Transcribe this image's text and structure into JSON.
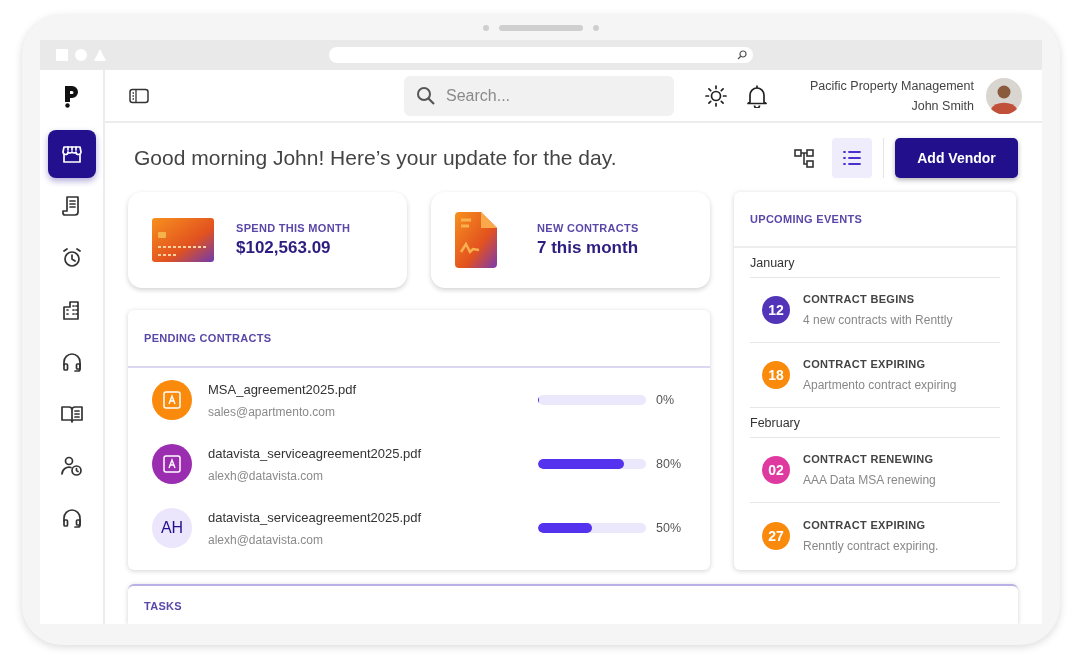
{
  "sidebar": {
    "items": [
      {
        "kind": "store",
        "selected": true
      },
      {
        "kind": "receipt",
        "selected": false
      },
      {
        "kind": "alarm",
        "selected": false
      },
      {
        "kind": "buildings",
        "selected": false
      },
      {
        "kind": "headset",
        "selected": false
      },
      {
        "kind": "book",
        "selected": false
      },
      {
        "kind": "user-clock",
        "selected": false
      },
      {
        "kind": "headset",
        "selected": false
      }
    ]
  },
  "header": {
    "search": {
      "placeholder": "Search..."
    },
    "company": "Pacific Property Management",
    "user": "John Smith"
  },
  "greeting": "Good morning John! Here’s your update for the day.",
  "view_toggle": [
    {
      "kind": "diagram",
      "selected": false
    },
    {
      "kind": "list",
      "selected": true
    }
  ],
  "add_button": "Add Vendor",
  "stats": [
    {
      "kind": "card",
      "label": "SPEND THIS MONTH",
      "value": "$102,563.09"
    },
    {
      "kind": "document",
      "label": "NEW CONTRACTS",
      "value": "7 this month"
    }
  ],
  "pending_contracts": {
    "title": "PENDING CONTRACTS",
    "rows": [
      {
        "kind": "logo",
        "color": "#f98a0c",
        "file": "MSA_agreement2025.pdf",
        "email": "sales@apartmento.com",
        "level": 0,
        "reading": "0%"
      },
      {
        "kind": "logo",
        "color": "#9b2db0",
        "file": "datavista_serviceagreement2025.pdf",
        "email": "alexh@datavista.com",
        "level": 0.8,
        "reading": "80%"
      },
      {
        "kind": "initials",
        "initials": "AH",
        "file": "datavista_serviceagreement2025.pdf",
        "email": "alexh@datavista.com",
        "level": 0.5,
        "reading": "50%"
      }
    ]
  },
  "upcoming_events": {
    "title": "UPCOMING EVENTS",
    "months": [
      {
        "name": "January",
        "events": [
          {
            "day": "12",
            "color": "#5234b8",
            "title": "CONTRACT BEGINS",
            "detail": "4 new contracts with Renttly"
          },
          {
            "day": "18",
            "color": "#f98a0c",
            "title": "CONTRACT EXPIRING",
            "detail": "Apartmento contract expiring"
          }
        ]
      },
      {
        "name": "February",
        "events": [
          {
            "day": "02",
            "color": "#de3aa0",
            "title": "CONTRACT RENEWING",
            "detail": "AAA Data MSA renewing"
          },
          {
            "day": "27",
            "color": "#f98a0c",
            "title": "CONTRACT EXPIRING",
            "detail": "Renntly contract expiring."
          }
        ]
      }
    ]
  },
  "tasks": {
    "title": "TASKS"
  }
}
